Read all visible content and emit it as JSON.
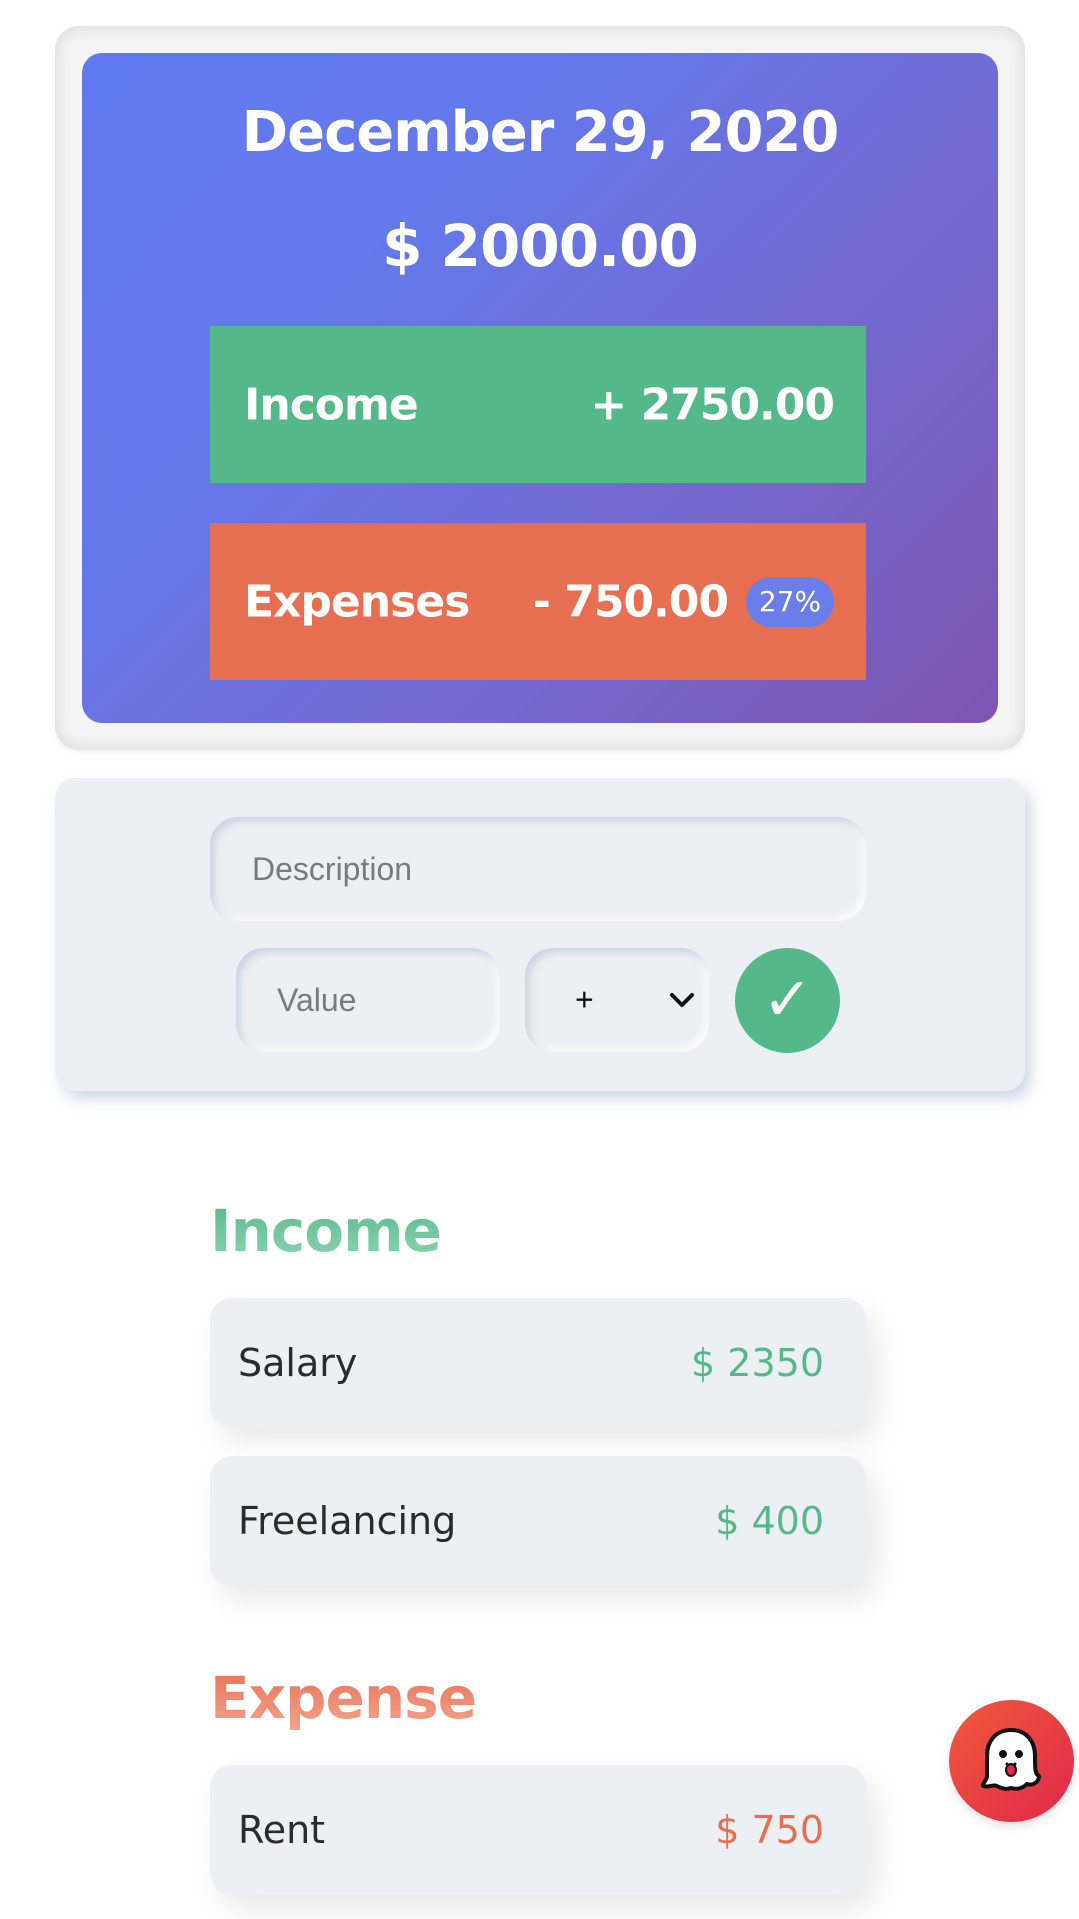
{
  "summary": {
    "date": "December 29, 2020",
    "balance": "$ 2000.00",
    "income_label": "Income",
    "income_value": "+ 2750.00",
    "expenses_label": "Expenses",
    "expenses_value": "- 750.00",
    "expenses_percent": "27%"
  },
  "form": {
    "description_placeholder": "Description",
    "value_placeholder": "Value",
    "type_selected": "+",
    "submit_symbol": "✓"
  },
  "income": {
    "title": "Income",
    "items": [
      {
        "name": "Salary",
        "amount": "$ 2350"
      },
      {
        "name": "Freelancing",
        "amount": "$ 400"
      }
    ]
  },
  "expense": {
    "title": "Expense",
    "items": [
      {
        "name": "Rent",
        "amount": "$ 750"
      }
    ]
  },
  "colors": {
    "income_green": "#54b88a",
    "expense_orange": "#e76f51",
    "accent_blue": "#6179ef",
    "fab_red": "#e0284a"
  },
  "icons": {
    "submit": "check-icon",
    "type_dropdown": "chevron-down-icon",
    "fab": "ghost-icon"
  }
}
